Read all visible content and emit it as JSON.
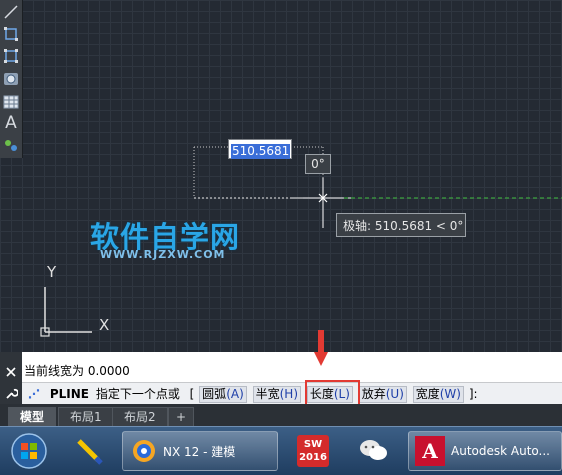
{
  "canvas": {
    "dynamic_input_value": "510.5681",
    "angle_value": "0°",
    "polar_tooltip": "极轴: 510.5681 < 0°",
    "ucs_x_label": "X",
    "ucs_y_label": "Y"
  },
  "watermark": {
    "main": "软件自学网",
    "url": "WWW.RJZXW.COM"
  },
  "toolbar": {
    "icons": [
      "line-icon",
      "rectangle-icon",
      "rectangle-select-icon",
      "circle-icon",
      "table-icon",
      "text-icon",
      "layer-icon"
    ],
    "text_glyph": "A"
  },
  "command": {
    "history": "当前线宽为 0.0000",
    "prefix": "PLINE",
    "prompt": "指定下一个点或",
    "bracket_open": "[",
    "bracket_close": "]:",
    "options": [
      {
        "label": "圆弧",
        "key": "(A)"
      },
      {
        "label": "半宽",
        "key": "(H)"
      },
      {
        "label": "长度",
        "key": "(L)"
      },
      {
        "label": "放弃",
        "key": "(U)"
      },
      {
        "label": "宽度",
        "key": "(W)"
      }
    ]
  },
  "tabs": [
    "模型",
    "布局1",
    "布局2",
    "+"
  ],
  "taskbar": {
    "items": [
      {
        "label": "",
        "icon": "windows-start-icon"
      },
      {
        "label": "",
        "icon": "pencil-app-icon"
      },
      {
        "label": "NX 12 - 建模",
        "icon": "nx-icon"
      },
      {
        "label": "",
        "icon": "solidworks-icon",
        "badge": "2016"
      },
      {
        "label": "",
        "icon": "wechat-icon"
      },
      {
        "label": "Autodesk Auto...",
        "icon": "autocad-icon"
      }
    ]
  },
  "colors": {
    "highlight": "#e23a33",
    "watermark": "#2aa6e6",
    "selection": "#3a6ed8"
  }
}
